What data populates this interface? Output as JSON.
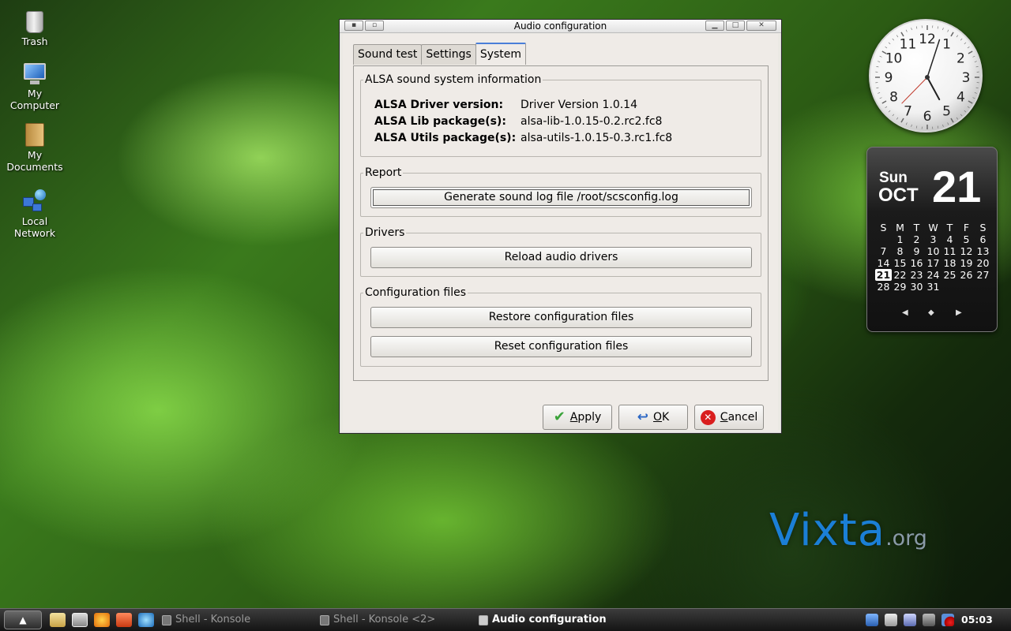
{
  "desktop": {
    "icons": [
      {
        "label_line1": "Trash",
        "label_line2": ""
      },
      {
        "label_line1": "My",
        "label_line2": "Computer"
      },
      {
        "label_line1": "My",
        "label_line2": "Documents"
      },
      {
        "label_line1": "Local",
        "label_line2": "Network"
      }
    ]
  },
  "window": {
    "title": "Audio configuration",
    "tabs": [
      {
        "label": "Sound test"
      },
      {
        "label": "Settings"
      },
      {
        "label": "System"
      }
    ],
    "alsa_group": {
      "title": "ALSA sound system information",
      "rows": [
        {
          "key": "ALSA Driver version:",
          "value": "Driver Version 1.0.14"
        },
        {
          "key": "ALSA Lib package(s):",
          "value": "alsa-lib-1.0.15-0.2.rc2.fc8"
        },
        {
          "key": "ALSA Utils package(s):",
          "value": "alsa-utils-1.0.15-0.3.rc1.fc8"
        }
      ]
    },
    "report_group": {
      "title": "Report",
      "generate_button": "Generate sound log file /root/scsconfig.log"
    },
    "drivers_group": {
      "title": "Drivers",
      "reload_button": "Reload audio drivers"
    },
    "config_group": {
      "title": "Configuration files",
      "restore_button": "Restore configuration files",
      "reset_button": "Reset configuration files"
    },
    "buttons": {
      "apply_first": "A",
      "apply_rest": "pply",
      "ok_first": "O",
      "ok_rest": "K",
      "cancel_first": "C",
      "cancel_rest": "ancel"
    }
  },
  "clock_widget": {
    "numbers": [
      "12",
      "1",
      "2",
      "3",
      "4",
      "5",
      "6",
      "7",
      "8",
      "9",
      "10",
      "11"
    ],
    "hour_value": 5,
    "minute_value": 3
  },
  "calendar_widget": {
    "weekday": "Sun",
    "month": "OCT",
    "day": "21",
    "weekday_headers": [
      "S",
      "M",
      "T",
      "W",
      "T",
      "F",
      "S"
    ],
    "weeks": [
      [
        "",
        "1",
        "2",
        "3",
        "4",
        "5",
        "6"
      ],
      [
        "7",
        "8",
        "9",
        "10",
        "11",
        "12",
        "13"
      ],
      [
        "14",
        "15",
        "16",
        "17",
        "18",
        "19",
        "20"
      ],
      [
        "21",
        "22",
        "23",
        "24",
        "25",
        "26",
        "27"
      ],
      [
        "28",
        "29",
        "30",
        "31",
        "",
        "",
        ""
      ]
    ],
    "today": "21",
    "nav_prev": "◀",
    "nav_home": "◆",
    "nav_next": "▶"
  },
  "logo": {
    "main": "Vixta",
    "suffix": ".org"
  },
  "taskbar": {
    "start_glyph": "▲",
    "tasks": [
      {
        "label": "Shell - Konsole"
      },
      {
        "label": "Shell - Konsole <2>"
      },
      {
        "label": "Audio configuration"
      }
    ],
    "clock": "05:03 am"
  },
  "colors": {
    "tab_active_accent": "#4a7ed8",
    "logo": "#1b7fd6",
    "cancel_icon": "#d91e1e",
    "apply_icon": "#3aa33a",
    "ok_icon": "#2a66c4"
  }
}
